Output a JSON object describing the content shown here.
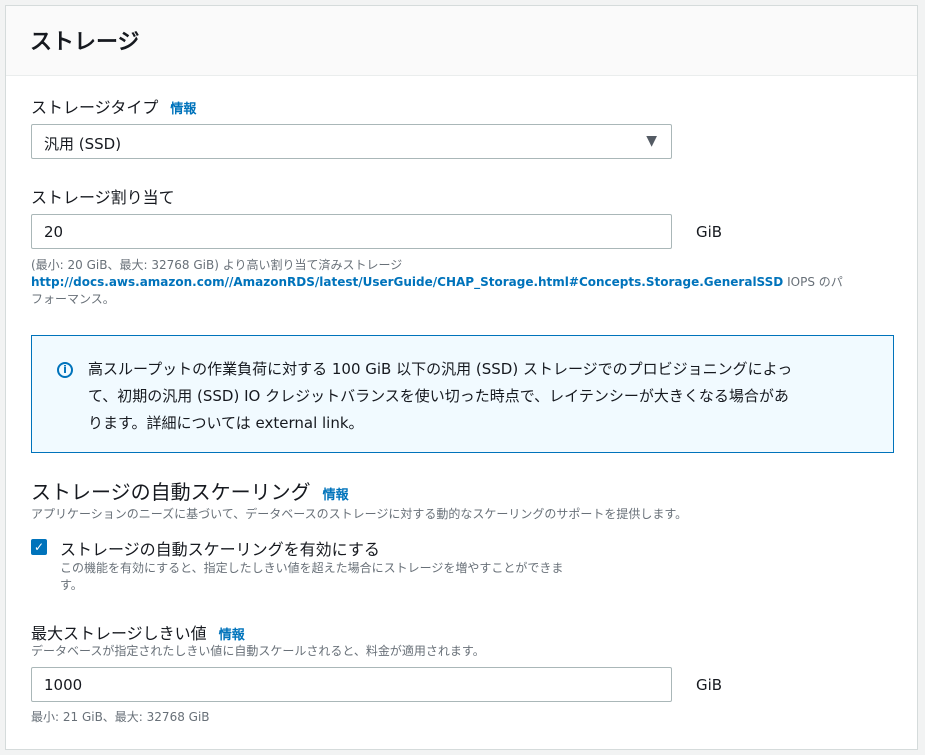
{
  "panel": {
    "title": "ストレージ"
  },
  "storage_type": {
    "label": "ストレージタイプ",
    "info": "情報",
    "selected": "汎用 (SSD)"
  },
  "allocation": {
    "label": "ストレージ割り当て",
    "value": "20",
    "unit": "GiB",
    "hint_line1": "(最小: 20 GiB、最大: 32768 GiB) より高い割り当て済みストレージ",
    "hint_link": "http://docs.aws.amazon.com//AmazonRDS/latest/UserGuide/CHAP_Storage.html#Concepts.Storage.GeneralSSD",
    "hint_suffix_1": " IOPS のパ",
    "hint_suffix_2": "フォーマンス。"
  },
  "alert": {
    "line1": "高スループットの作業負荷に対する 100 GiB 以下の汎用 (SSD) ストレージでのプロビジョニングによっ",
    "line2": "て、初期の汎用 (SSD) IO クレジットバランスを使い切った時点で、レイテンシーが大きくなる場合があ",
    "line3": "ります。詳細については external link。"
  },
  "autoscaling": {
    "title": "ストレージの自動スケーリング",
    "info": "情報",
    "description": "アプリケーションのニーズに基づいて、データベースのストレージに対する動的なスケーリングのサポートを提供します。",
    "checkbox_label": "ストレージの自動スケーリングを有効にする",
    "checkbox_hint_1": "この機能を有効にすると、指定したしきい値を超えた場合にストレージを増やすことができま",
    "checkbox_hint_2": "す。",
    "checked": true
  },
  "max_threshold": {
    "label": "最大ストレージしきい値",
    "info": "情報",
    "description": "データベースが指定されたしきい値に自動スケールされると、料金が適用されます。",
    "value": "1000",
    "unit": "GiB",
    "hint": "最小: 21 GiB、最大: 32768 GiB"
  },
  "colors": {
    "accent": "#0073bb",
    "alert_bg": "#f1faff",
    "hint_text": "#687078"
  }
}
